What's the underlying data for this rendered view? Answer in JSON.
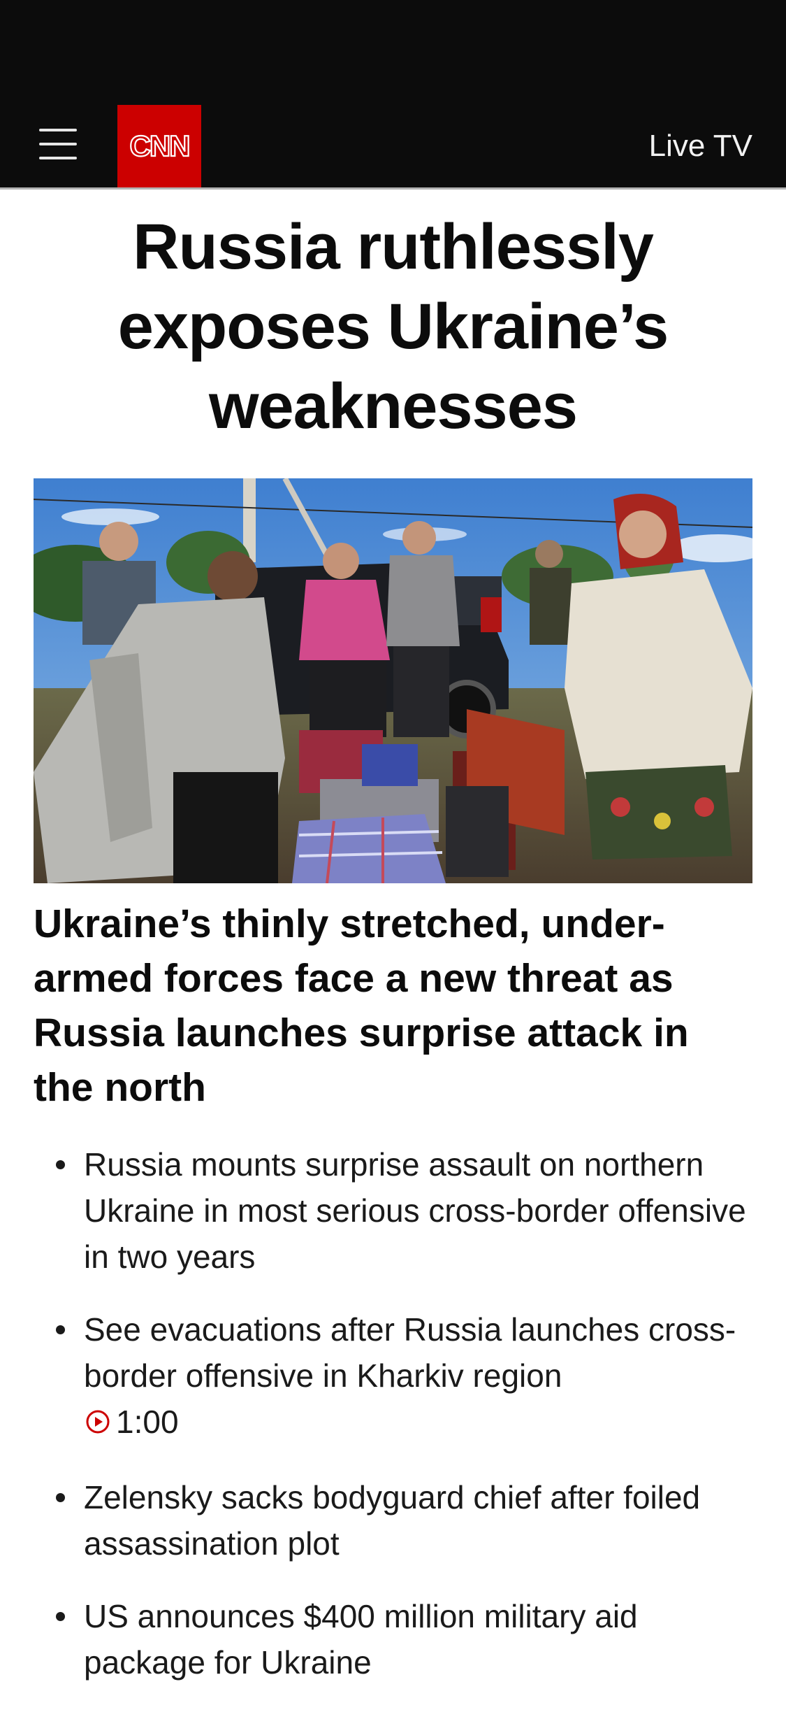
{
  "header": {
    "menu_icon": "hamburger-menu-icon",
    "logo_text": "CNN",
    "live_tv_label": "Live TV",
    "logo_color": "#cc0000",
    "bar_color": "#0c0c0c"
  },
  "article": {
    "headline": "Russia ruthlessly exposes Ukraine’s weaknesses",
    "hero_image_description_icon": "photo",
    "subheadline": "Ukraine’s thinly stretched, under-armed forces face a new threat as Russia launches surprise attack in the north"
  },
  "related": [
    {
      "text": "Russia mounts surprise assault on northern Ukraine in most serious cross-border offensive in two years"
    },
    {
      "text": "See evacuations after Russia launches cross-border offensive in Kharkiv region",
      "video_icon": "play-circle-icon",
      "duration": "1:00"
    },
    {
      "text": "Zelensky sacks bodyguard chief after foiled assassination plot"
    },
    {
      "text": "US announces $400 million military aid package for Ukraine"
    }
  ]
}
